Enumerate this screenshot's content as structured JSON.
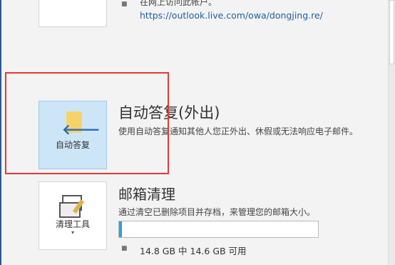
{
  "top_section": {
    "bullet": "■",
    "description": "在网上访问此帐户。",
    "link": "https://outlook.live.com/owa/dongjing.re/"
  },
  "auto_reply": {
    "tile_label": "自动答复",
    "title": "自动答复(外出)",
    "description": "使用自动答复通知其他人您正外出、休假或无法响应电子邮件。"
  },
  "mailbox_cleanup": {
    "tile_label": "清理工具",
    "caret": "▾",
    "title": "邮箱清理",
    "description": "通过清空已删除项目并存档，来管理您的邮箱大小。",
    "usage_fraction": 0.014,
    "bullet": "■",
    "usage_text": "14.8 GB 中 14.6 GB 可用"
  },
  "colors": {
    "accent": "#2b579a",
    "link": "#1e5ea8",
    "highlight": "#e53935",
    "progress": "#2aa3d6"
  }
}
